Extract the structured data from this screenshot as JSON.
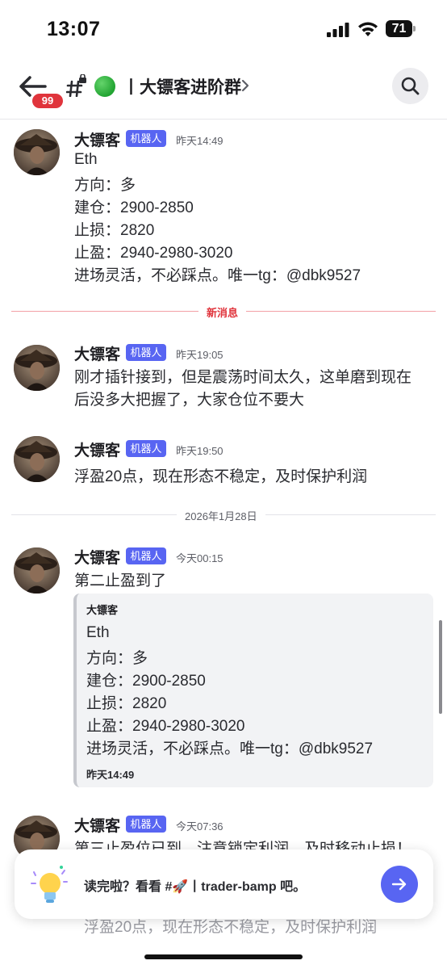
{
  "status_bar": {
    "time": "13:07",
    "battery": "71"
  },
  "header": {
    "unread_badge": "99",
    "channel_title": "丨大镖客进阶群",
    "green_dot_color": "#22a432",
    "brand_color": "#5865f2"
  },
  "messages": [
    {
      "author": "大镖客",
      "tag": "机器人",
      "time": "昨天14:49",
      "lines": [
        "Eth",
        "方向：多",
        "建仓：2900-2850",
        "止损：2820",
        "止盈：2940-2980-3020",
        "进场灵活，不必踩点。唯一tg：@dbk9527"
      ]
    },
    {
      "author": "大镖客",
      "tag": "机器人",
      "time": "昨天19:05",
      "lines": [
        "刚才插针接到，但是震荡时间太久，这单磨到现在",
        "后没多大把握了，大家仓位不要大"
      ]
    },
    {
      "author": "大镖客",
      "tag": "机器人",
      "time": "昨天19:50",
      "lines": [
        "浮盈20点，现在形态不稳定，及时保护利润"
      ]
    },
    {
      "author": "大镖客",
      "tag": "机器人",
      "time": "今天00:15",
      "lines": [
        "第二止盈到了"
      ],
      "quote": {
        "author": "大镖客",
        "lines": [
          "Eth",
          "方向：多",
          "建仓：2900-2850",
          "止损：2820",
          "止盈：2940-2980-3020",
          "进场灵活，不必踩点。唯一tg：@dbk9527"
        ],
        "time": "昨天14:49"
      }
    },
    {
      "author": "大镖客",
      "tag": "机器人",
      "time": "今天07:36",
      "lines": [
        "第三止盈位已到，注意锁定利润，及时移动止损！",
        "浮盈20点，现在形态不稳定，及时保护利润"
      ]
    }
  ],
  "dividers": {
    "new_messages": "新消息",
    "date": "2026年1月28日"
  },
  "prompt": {
    "text": "读完啦？看看 #🚀丨trader-bamp 吧。"
  }
}
